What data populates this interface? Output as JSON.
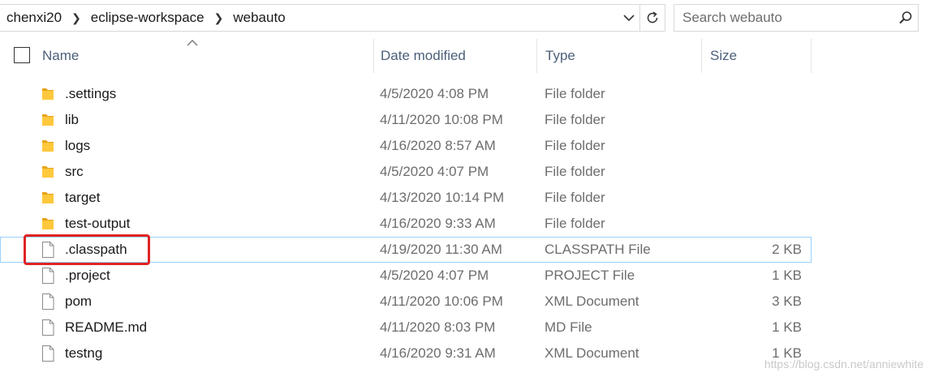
{
  "address": {
    "crumbs": [
      "chenxi20",
      "eclipse-workspace",
      "webauto"
    ]
  },
  "search": {
    "placeholder": "Search webauto"
  },
  "columns": {
    "name": "Name",
    "date": "Date modified",
    "type": "Type",
    "size": "Size"
  },
  "files": [
    {
      "name": ".settings",
      "date": "4/5/2020 4:08 PM",
      "type": "File folder",
      "size": "",
      "kind": "folder"
    },
    {
      "name": "lib",
      "date": "4/11/2020 10:08 PM",
      "type": "File folder",
      "size": "",
      "kind": "folder"
    },
    {
      "name": "logs",
      "date": "4/16/2020 8:57 AM",
      "type": "File folder",
      "size": "",
      "kind": "folder"
    },
    {
      "name": "src",
      "date": "4/5/2020 4:07 PM",
      "type": "File folder",
      "size": "",
      "kind": "folder"
    },
    {
      "name": "target",
      "date": "4/13/2020 10:14 PM",
      "type": "File folder",
      "size": "",
      "kind": "folder"
    },
    {
      "name": "test-output",
      "date": "4/16/2020 9:33 AM",
      "type": "File folder",
      "size": "",
      "kind": "folder"
    },
    {
      "name": ".classpath",
      "date": "4/19/2020 11:30 AM",
      "type": "CLASSPATH File",
      "size": "2 KB",
      "kind": "file",
      "selected": true
    },
    {
      "name": ".project",
      "date": "4/5/2020 4:07 PM",
      "type": "PROJECT File",
      "size": "1 KB",
      "kind": "file"
    },
    {
      "name": "pom",
      "date": "4/11/2020 10:06 PM",
      "type": "XML Document",
      "size": "3 KB",
      "kind": "file"
    },
    {
      "name": "README.md",
      "date": "4/11/2020 8:03 PM",
      "type": "MD File",
      "size": "1 KB",
      "kind": "file"
    },
    {
      "name": "testng",
      "date": "4/16/2020 9:31 AM",
      "type": "XML Document",
      "size": "1 KB",
      "kind": "file"
    }
  ],
  "watermark": "https://blog.csdn.net/anniewhite",
  "colors": {
    "folder": "#ffc83d",
    "selection_border": "#99d1ff",
    "annotation": "#e02424"
  }
}
